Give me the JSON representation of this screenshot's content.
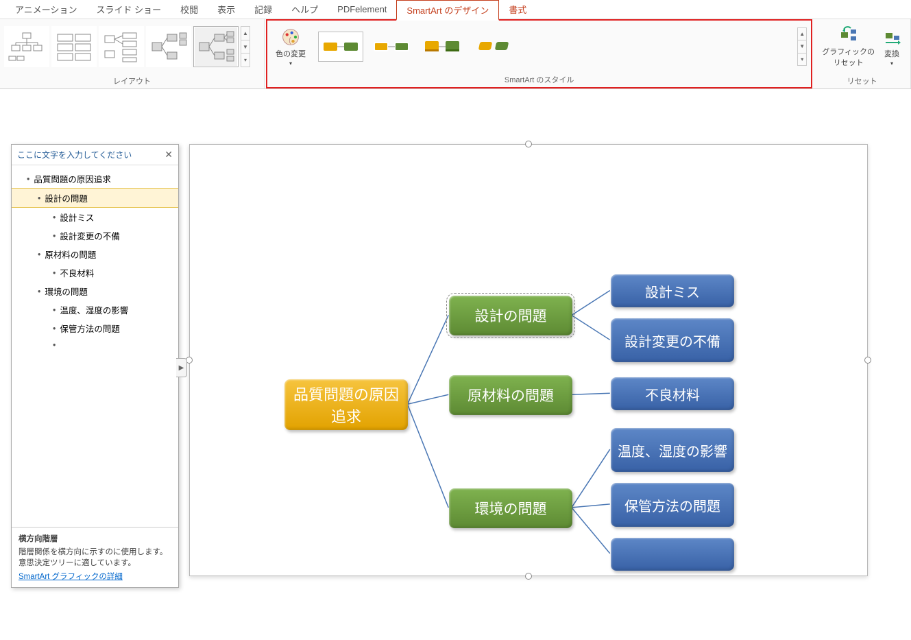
{
  "tabs": {
    "animation": "アニメーション",
    "slideshow": "スライド ショー",
    "review": "校閲",
    "view": "表示",
    "record": "記録",
    "help": "ヘルプ",
    "pdfelement": "PDFelement",
    "smartart_design": "SmartArt のデザイン",
    "format": "書式"
  },
  "ribbon": {
    "layout_label": "レイアウト",
    "color_change": "色の変更",
    "styles_label": "SmartArt のスタイル",
    "reset_graphic": "グラフィックの\nリセット",
    "convert": "変換",
    "reset_label": "リセット"
  },
  "textpane": {
    "header": "ここに文字を入力してください",
    "items": {
      "root": "品質問題の原因追求",
      "a": "設計の問題",
      "a1": "設計ミス",
      "a2": "設計変更の不備",
      "b": "原材料の問題",
      "b1": "不良材料",
      "c": "環境の問題",
      "c1": "温度、湿度の影響",
      "c2": "保管方法の問題",
      "blank": ""
    },
    "footer_title": "横方向階層",
    "footer_desc": "階層関係を横方向に示すのに使用します。意思決定ツリーに適しています。",
    "footer_link": "SmartArt グラフィックの詳細"
  },
  "smartart": {
    "root": "品質問題の原因追求",
    "n1": "設計の問題",
    "n2": "原材料の問題",
    "n3": "環境の問題",
    "m1": "設計ミス",
    "m2": "設計変更の不備",
    "m3": "不良材料",
    "m4": "温度、湿度の影響",
    "m5": "保管方法の問題",
    "m6": ""
  }
}
